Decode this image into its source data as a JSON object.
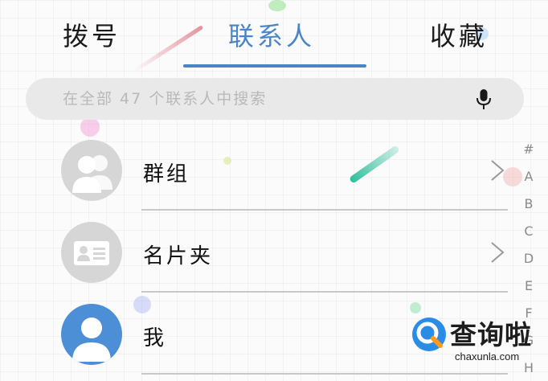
{
  "tabs": [
    {
      "label": "拨号",
      "active": false
    },
    {
      "label": "联系人",
      "active": true
    },
    {
      "label": "收藏",
      "active": false
    }
  ],
  "colors": {
    "accent": "#4a86c5",
    "avatar_gray": "#d6d6d6",
    "avatar_blue": "#4d8fd6",
    "search_bg": "#e9e9e9",
    "divider": "#c8c8c8"
  },
  "search": {
    "placeholder": "在全部 47 个联系人中搜索",
    "value": "",
    "icon": "microphone-icon"
  },
  "list": [
    {
      "label": "群组",
      "icon": "group-avatar-icon",
      "has_chevron": true
    },
    {
      "label": "名片夹",
      "icon": "business-card-icon",
      "has_chevron": true
    },
    {
      "label": "我",
      "icon": "my-profile-avatar-icon",
      "has_chevron": false
    }
  ],
  "alpha_index": [
    "#",
    "A",
    "B",
    "C",
    "D",
    "E",
    "F",
    "G",
    "H"
  ],
  "watermark": {
    "text": "查询啦",
    "url": "chaxunla.com"
  }
}
